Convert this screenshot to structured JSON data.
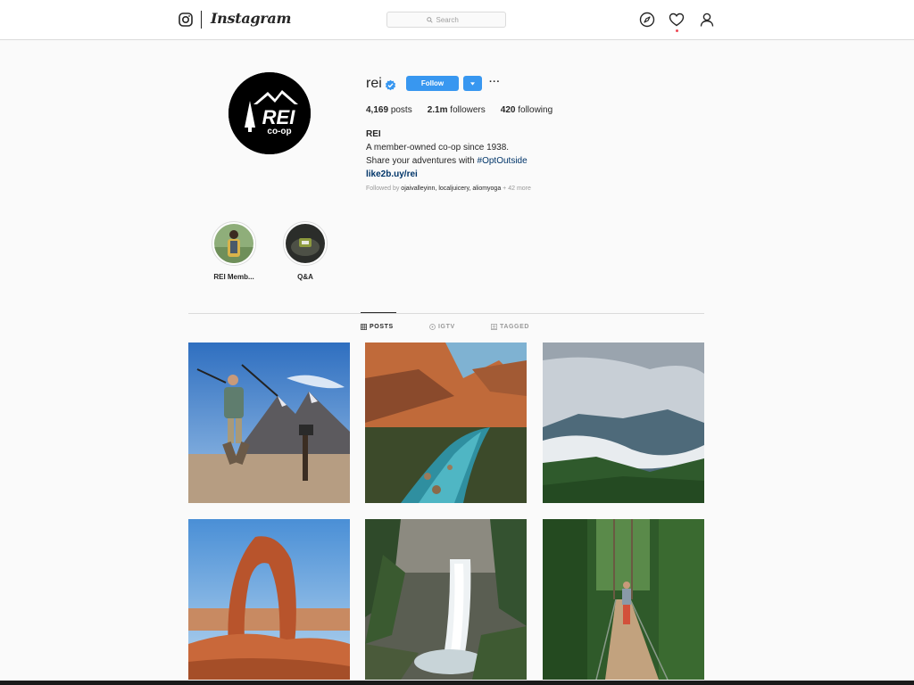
{
  "nav": {
    "wordmark": "Instagram",
    "search_placeholder": "Search",
    "icons": [
      "instagram-glyph-icon",
      "compass-icon",
      "heart-icon",
      "user-icon"
    ]
  },
  "profile": {
    "username": "rei",
    "verified": true,
    "follow_label": "Follow",
    "more_label": "···",
    "stats": {
      "posts_count": "4,169",
      "posts_label": "posts",
      "followers_count": "2.1m",
      "followers_label": "followers",
      "following_count": "420",
      "following_label": "following"
    },
    "bio": {
      "name": "REI",
      "line1": "A member-owned co-op since 1938.",
      "line2_prefix": "Share your adventures with ",
      "hashtag": "#OptOutside",
      "link": "like2b.uy/rei"
    },
    "followed_by": {
      "prefix": "Followed by ",
      "accounts": "ojaivalleyinn, localjuicery, aliomyoga",
      "suffix": " + 42 more"
    },
    "avatar_text": {
      "top": "REI",
      "bottom": "co-op"
    }
  },
  "highlights": [
    {
      "label": "REI Memb..."
    },
    {
      "label": "Q&A"
    }
  ],
  "tabs": [
    {
      "label": "POSTS",
      "active": true
    },
    {
      "label": "IGTV",
      "active": false
    },
    {
      "label": "TAGGED",
      "active": false
    }
  ],
  "posts": [
    {
      "subject": "hiker-jumping-mountains"
    },
    {
      "subject": "river-canyon-sunset"
    },
    {
      "subject": "misty-valley-mountains"
    },
    {
      "subject": "delicate-arch"
    },
    {
      "subject": "waterfall-forest"
    },
    {
      "subject": "suspension-bridge-forest"
    }
  ],
  "colors": {
    "accent": "#3897f0",
    "link": "#003569",
    "notification": "#ed4956"
  }
}
